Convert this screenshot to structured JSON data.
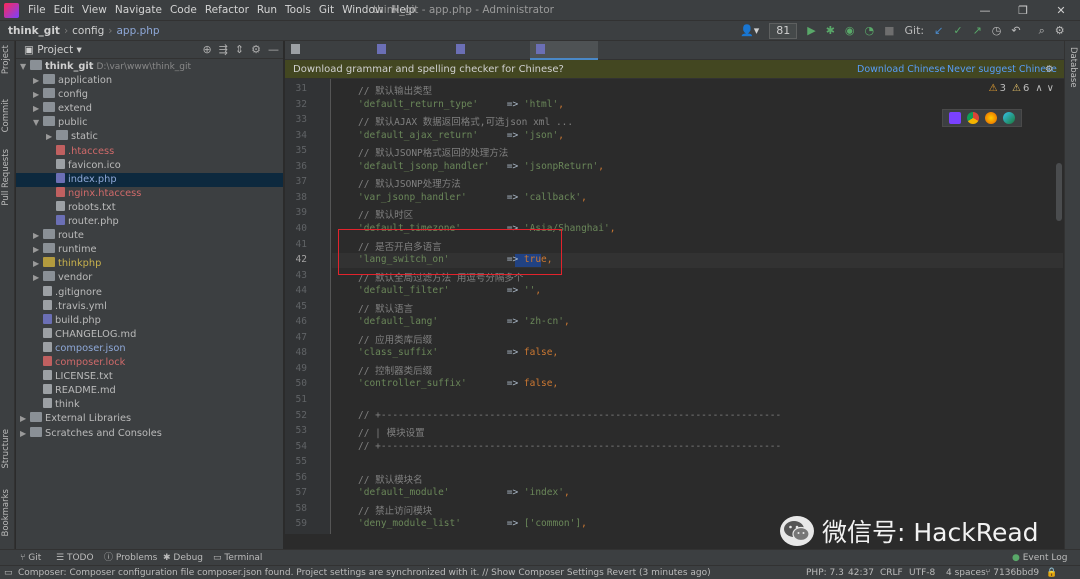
{
  "window": {
    "title": "think_git - app.php - Administrator",
    "menu": [
      "File",
      "Edit",
      "View",
      "Navigate",
      "Code",
      "Refactor",
      "Run",
      "Tools",
      "Git",
      "Window",
      "Help"
    ],
    "controls": [
      "—",
      "❐",
      "✕"
    ]
  },
  "navbar": {
    "breadcrumbs": [
      "think_git",
      "config",
      "app.php"
    ],
    "run_config": "81",
    "git_label": "Git:"
  },
  "tool_stripe_left": [
    "Project",
    "Commit",
    "Pull Requests",
    "Structure",
    "Bookmarks"
  ],
  "tool_stripe_right": [
    "Database"
  ],
  "project_panel": {
    "title": "Project",
    "root": {
      "name": "think_git",
      "path": "D:\\var\\www\\think_git"
    },
    "items": [
      {
        "label": "application",
        "kind": "folder",
        "depth": 1,
        "arrow": "▶"
      },
      {
        "label": "config",
        "kind": "folder",
        "depth": 1,
        "arrow": "▶"
      },
      {
        "label": "extend",
        "kind": "folder",
        "depth": 1,
        "arrow": "▶"
      },
      {
        "label": "public",
        "kind": "folder",
        "depth": 1,
        "arrow": "▼"
      },
      {
        "label": "static",
        "kind": "folder",
        "depth": 2,
        "arrow": "▶"
      },
      {
        "label": ".htaccess",
        "kind": "file-red",
        "depth": 2,
        "arrow": ""
      },
      {
        "label": "favicon.ico",
        "kind": "file",
        "depth": 2,
        "arrow": ""
      },
      {
        "label": "index.php",
        "kind": "file-php",
        "depth": 2,
        "arrow": "",
        "selected": true
      },
      {
        "label": "nginx.htaccess",
        "kind": "file-red",
        "depth": 2,
        "arrow": ""
      },
      {
        "label": "robots.txt",
        "kind": "file",
        "depth": 2,
        "arrow": ""
      },
      {
        "label": "router.php",
        "kind": "file-php",
        "depth": 2,
        "arrow": ""
      },
      {
        "label": "route",
        "kind": "folder",
        "depth": 1,
        "arrow": "▶"
      },
      {
        "label": "runtime",
        "kind": "folder",
        "depth": 1,
        "arrow": "▶"
      },
      {
        "label": "thinkphp",
        "kind": "folder-yellow",
        "depth": 1,
        "arrow": "▶"
      },
      {
        "label": "vendor",
        "kind": "folder",
        "depth": 1,
        "arrow": "▶"
      },
      {
        "label": ".gitignore",
        "kind": "file",
        "depth": 1,
        "arrow": ""
      },
      {
        "label": ".travis.yml",
        "kind": "file",
        "depth": 1,
        "arrow": ""
      },
      {
        "label": "build.php",
        "kind": "file-php",
        "depth": 1,
        "arrow": ""
      },
      {
        "label": "CHANGELOG.md",
        "kind": "file",
        "depth": 1,
        "arrow": ""
      },
      {
        "label": "composer.json",
        "kind": "file",
        "depth": 1,
        "arrow": ""
      },
      {
        "label": "composer.lock",
        "kind": "file-red",
        "depth": 1,
        "arrow": ""
      },
      {
        "label": "LICENSE.txt",
        "kind": "file",
        "depth": 1,
        "arrow": ""
      },
      {
        "label": "README.md",
        "kind": "file",
        "depth": 1,
        "arrow": ""
      },
      {
        "label": "think",
        "kind": "file",
        "depth": 1,
        "arrow": ""
      },
      {
        "label": "External Libraries",
        "kind": "folder",
        "depth": 0,
        "arrow": "▶"
      },
      {
        "label": "Scratches and Consoles",
        "kind": "folder",
        "depth": 0,
        "arrow": "▶"
      }
    ]
  },
  "tabs": [
    {
      "label": "README.md",
      "active": false
    },
    {
      "label": "router.php",
      "active": false
    },
    {
      "label": "index.php",
      "active": false
    },
    {
      "label": "app.php",
      "active": true
    }
  ],
  "notification": {
    "message": "Download grammar and spelling checker for Chinese?",
    "action1": "Download Chinese",
    "action2": "Never suggest Chinese"
  },
  "inspections": {
    "warnings": "3",
    "weak_warnings": "6"
  },
  "editor": {
    "lines": [
      {
        "n": "31",
        "type": "comment",
        "text": "// 默认输出类型"
      },
      {
        "n": "32",
        "type": "kv",
        "key": "'default_return_type'",
        "pad": "    ",
        "value": "'html'",
        "vtype": "str"
      },
      {
        "n": "33",
        "type": "comment",
        "text": "// 默认AJAX 数据返回格式,可选json xml ..."
      },
      {
        "n": "34",
        "type": "kv",
        "key": "'default_ajax_return'",
        "pad": "    ",
        "value": "'json'",
        "vtype": "str"
      },
      {
        "n": "35",
        "type": "comment",
        "text": "// 默认JSONP格式返回的处理方法"
      },
      {
        "n": "36",
        "type": "kv",
        "key": "'default_jsonp_handler'",
        "pad": "  ",
        "value": "'jsonpReturn'",
        "vtype": "str"
      },
      {
        "n": "37",
        "type": "comment",
        "text": "// 默认JSONP处理方法"
      },
      {
        "n": "38",
        "type": "kv",
        "key": "'var_jsonp_handler'",
        "pad": "      ",
        "value": "'callback'",
        "vtype": "str"
      },
      {
        "n": "39",
        "type": "comment",
        "text": "// 默认时区"
      },
      {
        "n": "40",
        "type": "kv",
        "key": "'default_timezone'",
        "pad": "       ",
        "value": "'Asia/Shanghai'",
        "vtype": "str"
      },
      {
        "n": "41",
        "type": "comment",
        "text": "// 是否开启多语言"
      },
      {
        "n": "42",
        "type": "kv",
        "key": "'lang_switch_on'",
        "pad": "         ",
        "value": "true",
        "vtype": "kw"
      },
      {
        "n": "43",
        "type": "comment",
        "text": "// 默认全局过滤方法 用逗号分隔多个"
      },
      {
        "n": "44",
        "type": "kv",
        "key": "'default_filter'",
        "pad": "         ",
        "value": "''",
        "vtype": "str"
      },
      {
        "n": "45",
        "type": "comment",
        "text": "// 默认语言"
      },
      {
        "n": "46",
        "type": "kv",
        "key": "'default_lang'",
        "pad": "           ",
        "value": "'zh-cn'",
        "vtype": "str"
      },
      {
        "n": "47",
        "type": "comment",
        "text": "// 应用类库后缀"
      },
      {
        "n": "48",
        "type": "kv",
        "key": "'class_suffix'",
        "pad": "           ",
        "value": "false",
        "vtype": "kw"
      },
      {
        "n": "49",
        "type": "comment",
        "text": "// 控制器类后缀"
      },
      {
        "n": "50",
        "type": "kv",
        "key": "'controller_suffix'",
        "pad": "      ",
        "value": "false",
        "vtype": "kw"
      },
      {
        "n": "51",
        "type": "blank",
        "text": ""
      },
      {
        "n": "52",
        "type": "comment",
        "text": "// +----------------------------------------------------------------------"
      },
      {
        "n": "53",
        "type": "comment",
        "text": "// | 模块设置"
      },
      {
        "n": "54",
        "type": "comment",
        "text": "// +----------------------------------------------------------------------"
      },
      {
        "n": "55",
        "type": "blank",
        "text": ""
      },
      {
        "n": "56",
        "type": "comment",
        "text": "// 默认模块名"
      },
      {
        "n": "57",
        "type": "kv",
        "key": "'default_module'",
        "pad": "         ",
        "value": "'index'",
        "vtype": "str"
      },
      {
        "n": "58",
        "type": "comment",
        "text": "// 禁止访问模块"
      },
      {
        "n": "59",
        "type": "kv",
        "key": "'deny_module_list'",
        "pad": "       ",
        "value": "['common']",
        "vtype": "str"
      }
    ],
    "current_line": "42"
  },
  "watermark": {
    "text": "微信号: HackRead"
  },
  "bottom_tools": [
    "Git",
    "TODO",
    "Problems",
    "Debug",
    "Terminal",
    "Event Log"
  ],
  "status": {
    "message": "Composer: Composer configuration file composer.json found. Project settings are synchronized with it. // Show Composer Settings   Revert (3 minutes ago)",
    "php": "PHP: 7.3",
    "position": "42:37",
    "line_sep": "CRLF",
    "encoding": "UTF-8",
    "indent": "4 spaces",
    "branch": "7136bbd9"
  }
}
